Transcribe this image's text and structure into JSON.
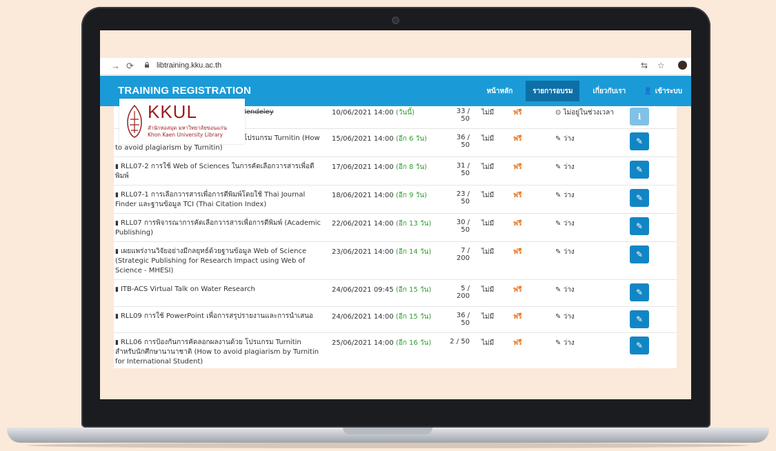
{
  "browser": {
    "url": "libtraining.kku.ac.th"
  },
  "app": {
    "brand": "TRAINING REGISTRATION",
    "menu": [
      {
        "label": "หน้าหลัก"
      },
      {
        "label": "รายการอบรม"
      },
      {
        "label": "เกี่ยวกับเรา"
      },
      {
        "label": "เข้าระบบ"
      }
    ]
  },
  "logo": {
    "title": "KKUL",
    "thai": "สำนักหอสมุด มหาวิทยาลัยขอนแก่น",
    "english": "Khon Kaen University Library"
  },
  "rows": [
    {
      "title": "รม Mendeley",
      "date": "10/06/2021 14:00",
      "relative": "(วันนี้)",
      "seats": "33 / 50",
      "condition": "ไม่มี",
      "fee": "ฟรี",
      "status": "ไม่อยู่ในช่วงเวลา"
    },
    {
      "title": "โปรแกรม Turnitin (How to avoid plagiarism by Turnitin)",
      "date": "15/06/2021 14:00",
      "relative": "(อีก 6 วัน)",
      "seats": "36 / 50",
      "condition": "ไม่มี",
      "fee": "ฟรี",
      "status": "ว่าง"
    },
    {
      "title": "RLL07-2 การใช้ Web of Sciences ในการคัดเลือกวารสารเพื่อตีพิมพ์",
      "date": "17/06/2021 14:00",
      "relative": "(อีก 8 วัน)",
      "seats": "31 / 50",
      "condition": "ไม่มี",
      "fee": "ฟรี",
      "status": "ว่าง"
    },
    {
      "title": "RLL07-1 การเลือกวารสารเพื่อการตีพิมพ์โดยใช้ Thai Journal Finder และฐานข้อมูล TCI (Thai Citation Index)",
      "date": "18/06/2021 14:00",
      "relative": "(อีก 9 วัน)",
      "seats": "23 / 50",
      "condition": "ไม่มี",
      "fee": "ฟรี",
      "status": "ว่าง"
    },
    {
      "title": "RLL07 การพิจารณาการคัดเลือกวารสารเพื่อการตีพิมพ์ (Academic Publishing)",
      "date": "22/06/2021 14:00",
      "relative": "(อีก 13 วัน)",
      "seats": "30 / 50",
      "condition": "ไม่มี",
      "fee": "ฟรี",
      "status": "ว่าง"
    },
    {
      "title": "เผยแพร่งานวิจัยอย่างมีกลยุทธ์ด้วยฐานข้อมูล Web of Science (Strategic Publishing for Research Impact using Web of Science - MHESI)",
      "date": "23/06/2021 14:00",
      "relative": "(อีก 14 วัน)",
      "seats": "7 / 200",
      "condition": "ไม่มี",
      "fee": "ฟรี",
      "status": "ว่าง"
    },
    {
      "title": "ITB-ACS Virtual Talk on Water Research",
      "date": "24/06/2021 09:45",
      "relative": "(อีก 15 วัน)",
      "seats": "5 / 200",
      "condition": "ไม่มี",
      "fee": "ฟรี",
      "status": "ว่าง"
    },
    {
      "title": "RLL09 การใช้ PowerPoint เพื่อการสรุปรายงานและการนำเสนอ",
      "date": "24/06/2021 14:00",
      "relative": "(อีก 15 วัน)",
      "seats": "36 / 50",
      "condition": "ไม่มี",
      "fee": "ฟรี",
      "status": "ว่าง"
    },
    {
      "title": "RLL06 การป้องกันการคัดลอกผลงานด้วย โปรแกรม Turnitin สำหรับนักศึกษานานาชาติ (How to avoid plagiarism by Turnitin for International Student)",
      "date": "25/06/2021 14:00",
      "relative": "(อีก 16 วัน)",
      "seats": "2 / 50",
      "condition": "ไม่มี",
      "fee": "ฟรี",
      "status": "ว่าง"
    }
  ]
}
